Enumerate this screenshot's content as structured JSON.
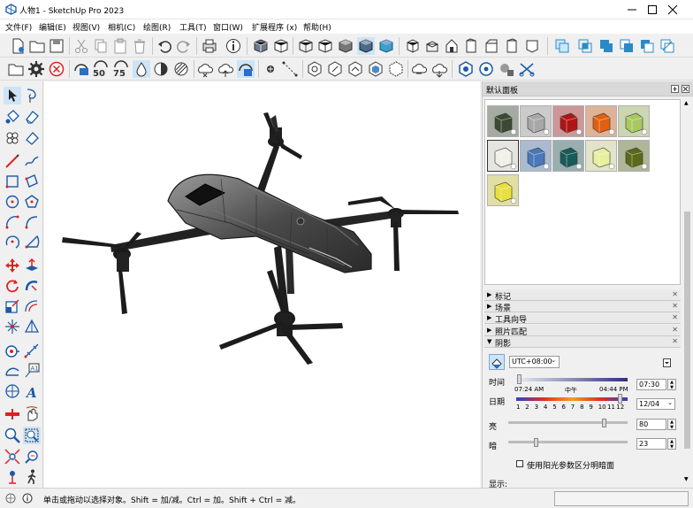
{
  "window": {
    "title": "人物1 - SketchUp Pro 2023"
  },
  "icons": [
    "sketchup-logo-icon",
    "minimize-icon",
    "maximize-icon",
    "close-icon"
  ],
  "menu": [
    "文件(F)",
    "编辑(E)",
    "视图(V)",
    "相机(C)",
    "绘图(R)",
    "工具(T)",
    "窗口(W)",
    "扩展程序 (x)",
    "帮助(H)"
  ],
  "tray": {
    "title": "默认面板",
    "panels": [
      "标记",
      "场景",
      "工具向导",
      "照片匹配",
      "阴影"
    ],
    "materials": [
      {
        "name": "dark-green-cube",
        "color": "#3c4a34"
      },
      {
        "name": "gray-cube",
        "color": "#a8a8a8"
      },
      {
        "name": "red-cube",
        "color": "#b01515"
      },
      {
        "name": "orange-cube",
        "color": "#e06010"
      },
      {
        "name": "light-green-cube",
        "color": "#a8c860"
      },
      {
        "name": "white-cube",
        "color": "#f0f0e8"
      },
      {
        "name": "blue-cube",
        "color": "#4a78b8"
      },
      {
        "name": "teal-cube",
        "color": "#1a5a5a"
      },
      {
        "name": "pale-yellow-cube",
        "color": "#e8f0a0"
      },
      {
        "name": "olive-cube",
        "color": "#5a6a18"
      },
      {
        "name": "yellow-cube",
        "color": "#e8e040"
      }
    ]
  },
  "shadows": {
    "timezone": "UTC+08:00",
    "time_label": "时间",
    "time_start": "07:24 AM",
    "time_mid": "中午",
    "time_end": "04:44 PM",
    "time_value": "07:30",
    "time_fraction": 0.02,
    "date_label": "日期",
    "months": [
      "1",
      "2",
      "3",
      "4",
      "5",
      "6",
      "7",
      "8",
      "9",
      "10",
      "11",
      "12"
    ],
    "date_value": "12/04",
    "date_fraction": 0.93,
    "light_label": "亮",
    "light_value": "80",
    "light_fraction": 0.8,
    "dark_label": "暗",
    "dark_value": "23",
    "dark_fraction": 0.23,
    "sun_checkbox_label": "使用阳光参数区分明暗面",
    "display_label": "显示:"
  },
  "status": {
    "text": "单击或拖动以选择对象。Shift = 加/减。Ctrl = 加。Shift + Ctrl = 减。",
    "measure_value": ""
  }
}
